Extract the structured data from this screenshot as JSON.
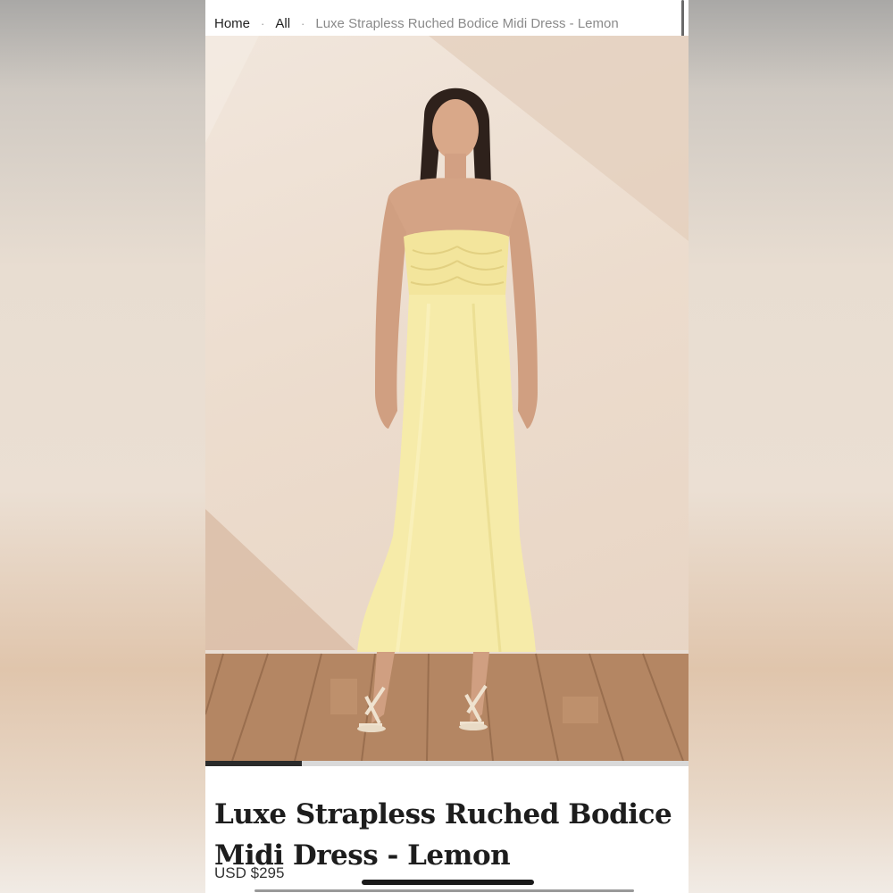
{
  "breadcrumb": {
    "items": [
      "Home",
      "All"
    ],
    "separator": "·",
    "current": "Luxe Strapless Ruched Bodice Midi Dress - Lemon"
  },
  "product": {
    "title": "Luxe Strapless Ruched Bodice Midi Dress - Lemon",
    "price": "USD $295",
    "image_alt": "Model wearing lemon strapless ruched bodice midi dress"
  },
  "gallery": {
    "progress_fraction": 0.2
  },
  "colors": {
    "dress": "#f5eaa6",
    "wall": "#eddccd",
    "floor": "#b48663",
    "text": "#1d1d1d"
  }
}
